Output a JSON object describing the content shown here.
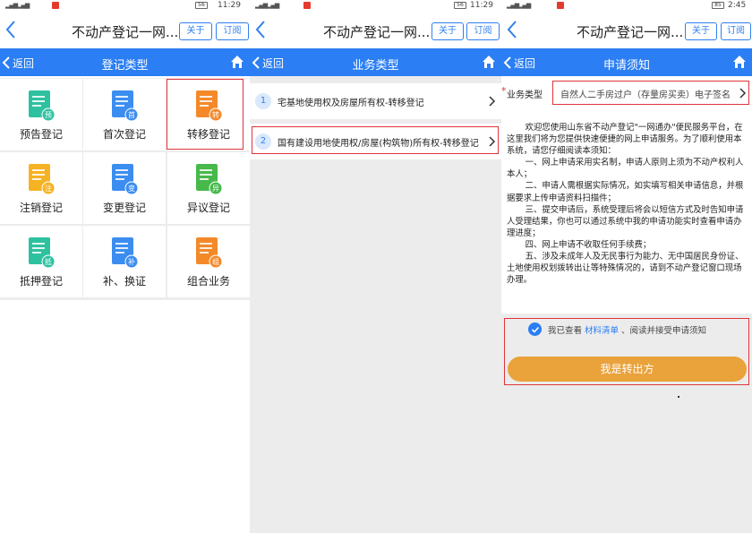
{
  "status": {
    "p1": {
      "battery": "56",
      "time": "11:29"
    },
    "p2": {
      "battery": "56",
      "time": "11:29"
    },
    "p3": {
      "battery": "85",
      "time": "2:45"
    }
  },
  "appbar": {
    "title": "不动产登记一网...",
    "about_label": "关于",
    "subscribe_label": "订阅"
  },
  "nav": {
    "back_label": "返回",
    "p1_title": "登记类型",
    "p2_title": "业务类型",
    "p3_title": "申请须知"
  },
  "registration_types": [
    {
      "label": "预告登记",
      "badge": "预",
      "color": "#2ec1a0"
    },
    {
      "label": "首次登记",
      "badge": "首",
      "color": "#3b8df0"
    },
    {
      "label": "转移登记",
      "badge": "转",
      "color": "#f4892a"
    },
    {
      "label": "注销登记",
      "badge": "注",
      "color": "#f5b324"
    },
    {
      "label": "变更登记",
      "badge": "变",
      "color": "#3b8df0"
    },
    {
      "label": "异议登记",
      "badge": "异",
      "color": "#46b94a"
    },
    {
      "label": "抵押登记",
      "badge": "抵",
      "color": "#2ec1a0"
    },
    {
      "label": "补、换证",
      "badge": "补",
      "color": "#3b8df0"
    },
    {
      "label": "组合业务",
      "badge": "组",
      "color": "#f4892a"
    }
  ],
  "business_types": [
    {
      "num": "1",
      "label": "宅基地使用权及房屋所有权-转移登记"
    },
    {
      "num": "2",
      "label": "国有建设用地使用权/房屋(构筑物)所有权-转移登记"
    }
  ],
  "notice": {
    "field_label": "业务类型",
    "field_value": "自然人二手房过户（存量房买卖）电子签名",
    "paragraphs": [
      "欢迎您使用山东省不动产登记\"一网通办\"便民服务平台，在这里我们将为您提供快速便捷的网上申请服务。为了顺利使用本系统，请您仔细阅读本须知：",
      "一、网上申请采用实名制，申请人原则上须为不动产权利人本人；",
      "二、申请人需根据实际情况，如实填写相关申请信息，并根据要求上传申请资料扫描件；",
      "三、提交申请后，系统受理后将会以短信方式及时告知申请人受理结果，你也可以通过系统中我的申请功能实时查看申请办理进度；",
      "四、网上申请不收取任何手续费；",
      "五、涉及未成年人及无民事行为能力、无中国居民身份证、土地使用权划拨转出让等特殊情况的，请到不动产登记窗口现场办理。"
    ],
    "agree_prefix": "我已查看",
    "agree_link": "材料清单",
    "agree_suffix": "、阅读并接受申请须知",
    "button_label": "我是转出方"
  }
}
